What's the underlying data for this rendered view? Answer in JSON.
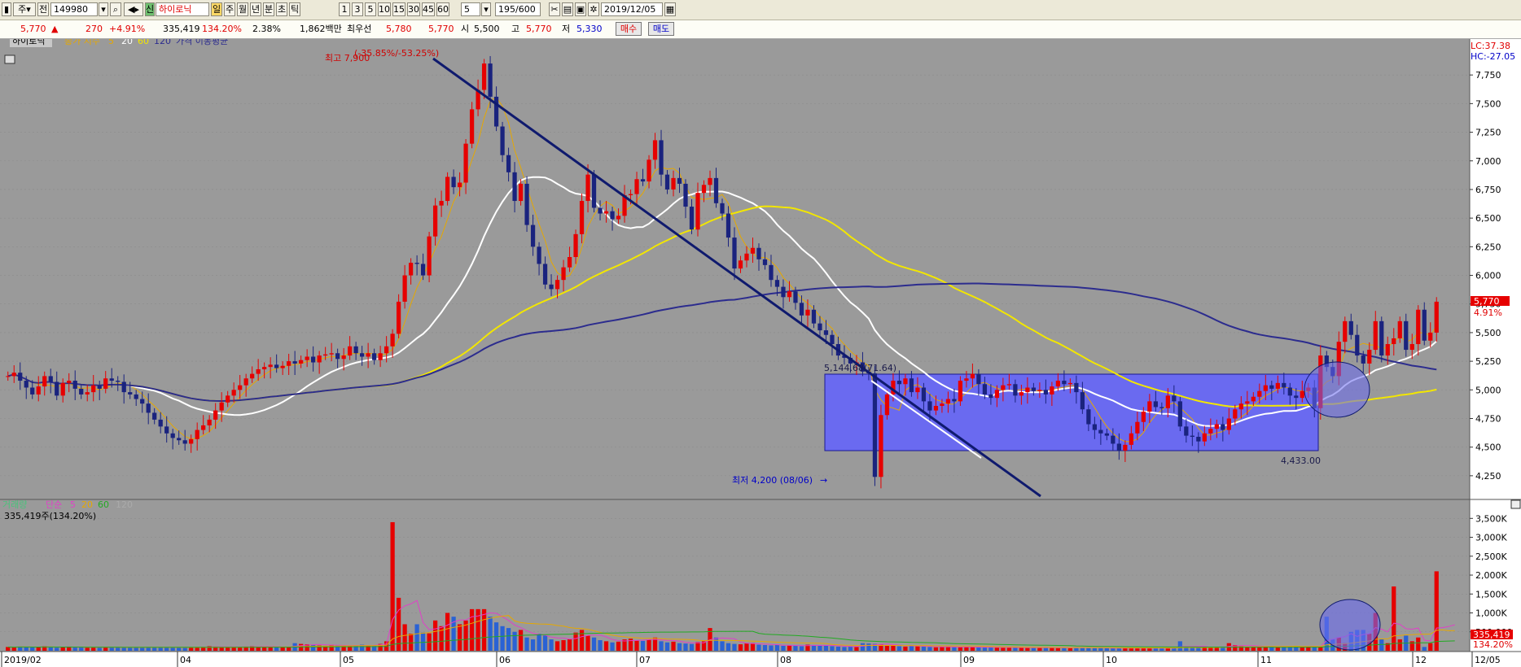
{
  "toolbar": {
    "period_label": "주",
    "market_label": "전",
    "code": "149980",
    "stock_name": "하이로닉",
    "tabs": [
      "일",
      "주",
      "월",
      "년",
      "분",
      "초",
      "틱"
    ],
    "intervals": [
      "1",
      "3",
      "5",
      "10",
      "15",
      "30",
      "45",
      "60"
    ],
    "interval_value": "5",
    "count": "195",
    "count_max": "/600",
    "date": "2019/12/05"
  },
  "quote": {
    "price": "5,770",
    "change": "270",
    "change_pct": "+4.91%",
    "volume": "335,419",
    "volume_ratio": "134.20%",
    "turnover": "2.38%",
    "amount": "1,862백만",
    "best_label": "최우선",
    "best_sell": "5,780",
    "best_buy": "5,770",
    "open_label": "시",
    "open": "5,500",
    "high_label": "고",
    "high": "5,770",
    "low_label": "저",
    "low": "5,330",
    "buy_button": "매수",
    "sell_button": "매도"
  },
  "legend": {
    "name": "하이로닉",
    "ma_type": "종가 지수",
    "periods": [
      "5",
      "20",
      "60",
      "120"
    ],
    "ma_title": "가격 이동평균"
  },
  "annotations": {
    "high": "최고 7,900",
    "high_pct": "(-35.85%/-53.25%)",
    "box_top": "5,144.68(71.64)",
    "low": "최저 4,200 (08/06)",
    "box_bottom": "4,433.00"
  },
  "volume_legend": {
    "label": "거래량",
    "ma_type": "단순",
    "periods": [
      "5",
      "20",
      "60",
      "120"
    ],
    "value": "335,419주(134.20%)"
  },
  "right_panel": {
    "lc": "LC:37.38",
    "hc": "HC:-27.05",
    "price_tag": "5,770",
    "pct_tag": "4.91%",
    "vol_tag": "335,419",
    "vol_pct_tag": "134.20%"
  },
  "colors": {
    "up": "#e60000",
    "down": "#1a237e",
    "background": "#9a9a9a",
    "box": "#6a6af0",
    "ma5": "#e6a800",
    "ma20": "#ffffff",
    "ma60": "#f2e600",
    "ma120": "#2c2c8e"
  },
  "chart_data": {
    "type": "candlestick",
    "y_ticks": [
      "7,750",
      "7,500",
      "7,250",
      "7,000",
      "6,750",
      "6,500",
      "6,250",
      "6,000",
      "5,750",
      "5,500",
      "5,250",
      "5,000",
      "4,750",
      "4,500",
      "4,250"
    ],
    "ylim": [
      4100,
      8000
    ],
    "x_ticks": [
      "2019/02",
      "04",
      "05",
      "06",
      "07",
      "08",
      "09",
      "10",
      "11",
      "12",
      "12/05"
    ],
    "volume_ticks": [
      "3,500K",
      "3,000K",
      "2,500K",
      "2,000K",
      "1,500K",
      "1,000K",
      "500,000"
    ],
    "volume_ylim": [
      0,
      3700000
    ],
    "close": [
      5120,
      5150,
      5080,
      5020,
      4960,
      5030,
      5120,
      5070,
      4950,
      5060,
      5080,
      5010,
      4960,
      4980,
      5040,
      5010,
      5100,
      5080,
      5070,
      4980,
      4960,
      4920,
      4880,
      4800,
      4740,
      4680,
      4620,
      4580,
      4560,
      4530,
      4570,
      4650,
      4690,
      4740,
      4820,
      4890,
      4950,
      5000,
      5040,
      5100,
      5140,
      5180,
      5200,
      5220,
      5190,
      5210,
      5250,
      5230,
      5260,
      5290,
      5240,
      5300,
      5310,
      5320,
      5270,
      5300,
      5380,
      5320,
      5290,
      5320,
      5260,
      5320,
      5380,
      5490,
      5770,
      6000,
      6110,
      6100,
      6000,
      6340,
      6610,
      6650,
      6860,
      6770,
      6810,
      7150,
      7450,
      7620,
      7850,
      7560,
      7300,
      7050,
      6900,
      6650,
      6800,
      6440,
      6250,
      6100,
      5920,
      5880,
      5960,
      6070,
      6160,
      6360,
      6650,
      6880,
      6590,
      6540,
      6560,
      6490,
      6520,
      6700,
      6710,
      6840,
      6820,
      7010,
      7180,
      6880,
      6750,
      6850,
      6800,
      6600,
      6400,
      6720,
      6790,
      6850,
      6630,
      6540,
      6330,
      6060,
      6130,
      6190,
      6240,
      6140,
      6090,
      5960,
      5900,
      5810,
      5860,
      5760,
      5650,
      5700,
      5580,
      5520,
      5480,
      5400,
      5300,
      5280,
      5230,
      5240,
      5160,
      5144,
      4240,
      4780,
      4960,
      5080,
      5050,
      5100,
      4980,
      5020,
      4900,
      4820,
      4860,
      4880,
      4920,
      4900,
      5080,
      5100,
      5140,
      5050,
      4960,
      4930,
      5000,
      5040,
      5050,
      4950,
      4980,
      5020,
      4990,
      5000,
      4960,
      5030,
      5080,
      5050,
      5060,
      4980,
      4830,
      4700,
      4650,
      4620,
      4600,
      4530,
      4470,
      4520,
      4620,
      4720,
      4810,
      4900,
      4850,
      4840,
      4950,
      4900,
      4680,
      4600,
      4590,
      4550,
      4620,
      4660,
      4700,
      4650,
      4750,
      4830,
      4880,
      4900,
      4940,
      4990,
      5040,
      5010,
      5060,
      5020,
      4950,
      4930,
      4990,
      5020,
      4840,
      5300,
      5200,
      5120,
      5420,
      5600,
      5480,
      5300,
      5230,
      5350,
      5600,
      5300,
      5400,
      5450,
      5600,
      5350,
      5400,
      5700,
      5430,
      5500,
      5770
    ],
    "volume": [
      100000,
      90000,
      110000,
      95000,
      85000,
      100000,
      120000,
      90000,
      80000,
      95000,
      110000,
      90000,
      85000,
      80000,
      90000,
      95000,
      100000,
      90000,
      85000,
      80000,
      90000,
      85000,
      95000,
      100000,
      90000,
      85000,
      80000,
      90000,
      85000,
      80000,
      90000,
      95000,
      100000,
      120000,
      110000,
      100000,
      90000,
      95000,
      100000,
      110000,
      120000,
      115000,
      110000,
      100000,
      90000,
      95000,
      100000,
      200000,
      180000,
      170000,
      150000,
      140000,
      130000,
      160000,
      150000,
      130000,
      120000,
      140000,
      160000,
      150000,
      140000,
      180000,
      250000,
      3400000,
      1400000,
      700000,
      450000,
      700000,
      480000,
      460000,
      800000,
      650000,
      1000000,
      900000,
      700000,
      800000,
      1100000,
      1100000,
      1100000,
      900000,
      750000,
      650000,
      600000,
      500000,
      550000,
      350000,
      300000,
      450000,
      400000,
      300000,
      250000,
      280000,
      300000,
      480000,
      550000,
      400000,
      350000,
      280000,
      250000,
      220000,
      240000,
      300000,
      320000,
      280000,
      260000,
      300000,
      350000,
      250000,
      220000,
      240000,
      200000,
      190000,
      180000,
      230000,
      250000,
      600000,
      350000,
      250000,
      200000,
      180000,
      170000,
      190000,
      200000,
      160000,
      150000,
      140000,
      150000,
      130000,
      140000,
      130000,
      120000,
      160000,
      150000,
      140000,
      130000,
      120000,
      110000,
      100000,
      110000,
      100000,
      200000,
      190000,
      180000,
      160000,
      150000,
      130000,
      120000,
      110000,
      130000,
      120000,
      110000,
      100000,
      90000,
      100000,
      110000,
      100000,
      90000,
      100000,
      95000,
      90000,
      85000,
      90000,
      85000,
      80000,
      90000,
      85000,
      80000,
      75000,
      80000,
      85000,
      80000,
      75000,
      70000,
      80000,
      75000,
      90000,
      85000,
      80000,
      70000,
      75000,
      70000,
      65000,
      70000,
      65000,
      70000,
      75000,
      70000,
      65000,
      80000,
      75000,
      70000,
      65000,
      250000,
      100000,
      90000,
      80000,
      85000,
      90000,
      100000,
      110000,
      200000,
      150000,
      120000,
      100000,
      110000,
      130000,
      120000,
      110000,
      100000,
      110000,
      120000,
      130000,
      100000,
      120000,
      110000,
      100000,
      900000,
      300000,
      350000,
      200000,
      500000,
      550000,
      550000,
      450000,
      1000000,
      300000,
      200000,
      1700000,
      300000,
      400000,
      250000,
      350000,
      100000,
      200000,
      2100000,
      300000,
      500000,
      335419
    ]
  }
}
